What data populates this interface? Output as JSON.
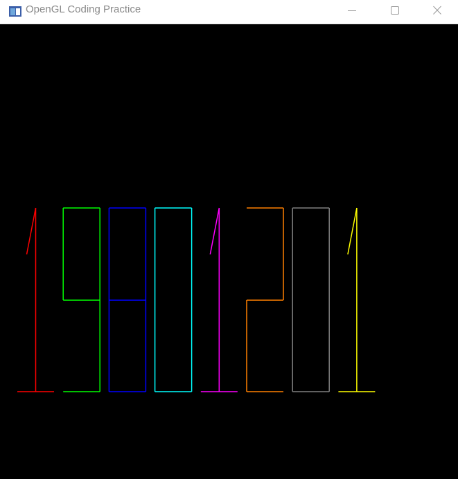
{
  "window": {
    "title": "OpenGL Coding Practice"
  },
  "titlebar_buttons": {
    "minimize": "minimize-icon",
    "maximize": "maximize-icon",
    "close": "close-icon"
  },
  "canvas": {
    "background": "#000000",
    "digits": [
      {
        "char": "1",
        "color": "#ff0000"
      },
      {
        "char": "9",
        "color": "#00ff00"
      },
      {
        "char": "8",
        "color": "#0000ff"
      },
      {
        "char": "0",
        "color": "#00ffff"
      },
      {
        "char": "1",
        "color": "#ff00ff"
      },
      {
        "char": "2",
        "color": "#ff8000"
      },
      {
        "char": "0",
        "color": "#808080"
      },
      {
        "char": "1",
        "color": "#ffff00"
      }
    ]
  }
}
